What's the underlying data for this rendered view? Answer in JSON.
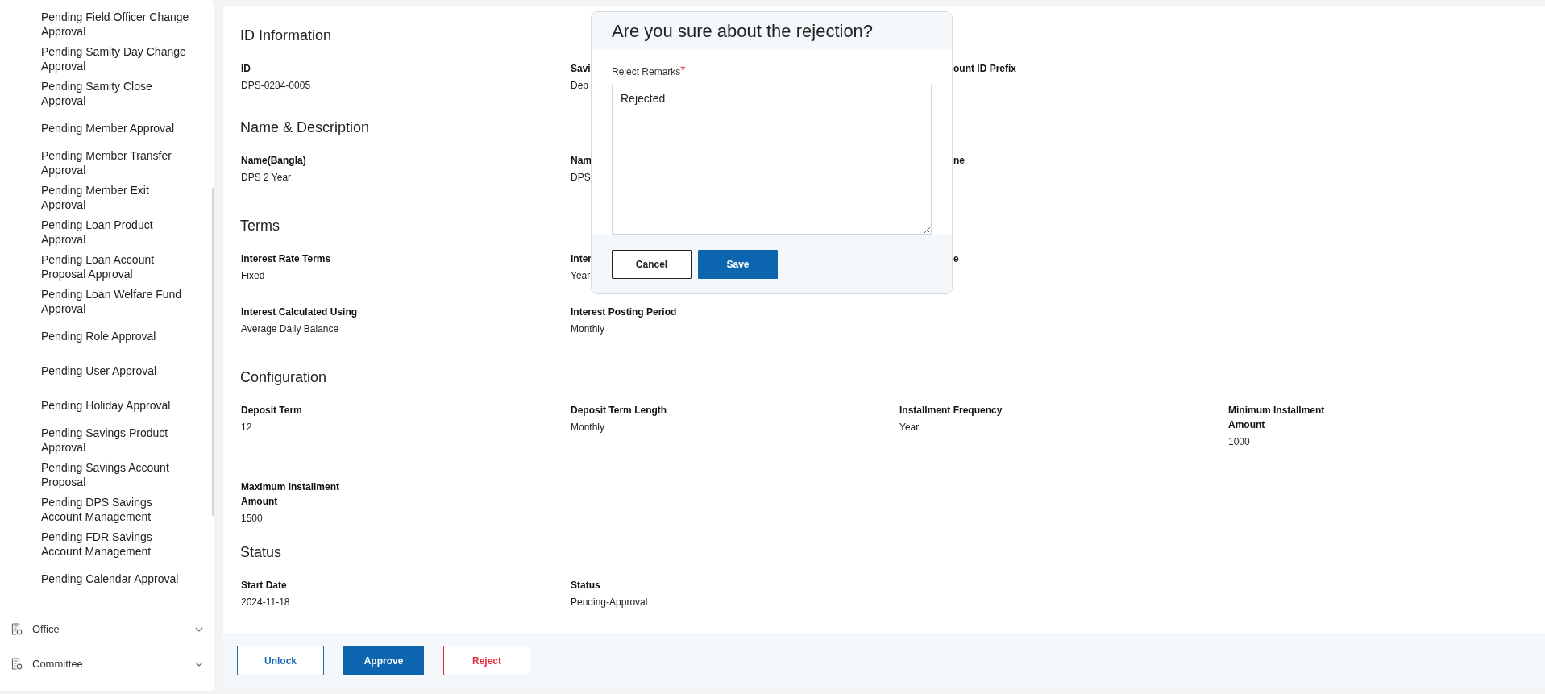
{
  "sidebar": {
    "items": [
      {
        "label": "Pending Field Officer Change Approval"
      },
      {
        "label": "Pending Samity Day Change Approval"
      },
      {
        "label": "Pending Samity Close Approval"
      },
      {
        "label": "Pending Member Approval"
      },
      {
        "label": "Pending Member Transfer Approval"
      },
      {
        "label": "Pending Member Exit Approval"
      },
      {
        "label": "Pending Loan Product Approval"
      },
      {
        "label": "Pending Loan Account Proposal Approval"
      },
      {
        "label": "Pending Loan Welfare Fund Approval"
      },
      {
        "label": "Pending Role Approval"
      },
      {
        "label": "Pending User Approval"
      },
      {
        "label": "Pending Holiday Approval"
      },
      {
        "label": "Pending Savings Product Approval"
      },
      {
        "label": "Pending Savings Account Proposal"
      },
      {
        "label": "Pending DPS Savings Account Management"
      },
      {
        "label": "Pending FDR Savings Account Management"
      },
      {
        "label": "Pending Calendar Approval"
      }
    ],
    "groups": [
      {
        "label": "Office",
        "expanded": false
      },
      {
        "label": "Committee",
        "expanded": false
      }
    ]
  },
  "sections": [
    {
      "title": "ID Information",
      "rows": [
        [
          {
            "label": "ID",
            "value": "DPS-0284-0005"
          },
          {
            "label": "Savi",
            "value": "Dep"
          },
          {
            "label": "ount ID Prefix"
          }
        ]
      ]
    },
    {
      "title": "Name & Description",
      "rows": [
        [
          {
            "label": "Name(Bangla)",
            "value": "DPS 2 Year"
          },
          {
            "label": "Nam",
            "value": "DPS"
          },
          {
            "label": "ne"
          }
        ]
      ]
    },
    {
      "title": "Terms",
      "rows": [
        [
          {
            "label": "Interest Rate Terms",
            "value": "Fixed"
          },
          {
            "label": "Inter",
            "value": "Year"
          },
          {
            "label": "e"
          }
        ],
        [
          {
            "label": "Interest Calculated Using",
            "value": "Average Daily Balance"
          },
          {
            "label": "Interest Posting Period",
            "value": "Monthly"
          }
        ]
      ]
    },
    {
      "title": "Configuration",
      "rows": [
        [
          {
            "label": "Deposit Term",
            "value": "12"
          },
          {
            "label": "Deposit Term Length",
            "value": "Monthly"
          },
          {
            "label": "Installment Frequency",
            "value": "Year"
          },
          {
            "label": "Minimum Installment Amount",
            "value": "1000"
          }
        ],
        [
          {
            "label": "Maximum Installment Amount",
            "value": "1500"
          }
        ]
      ]
    },
    {
      "title": "Status",
      "rows": [
        [
          {
            "label": "Start Date",
            "value": "2024-11-18"
          },
          {
            "label": "Status",
            "value": "Pending-Approval"
          }
        ]
      ]
    }
  ],
  "actions": [
    {
      "label": "Unlock",
      "kind": "outline"
    },
    {
      "label": "Approve",
      "kind": "primary"
    },
    {
      "label": "Reject",
      "kind": "danger"
    }
  ],
  "dialog": {
    "title": "Are you sure about the rejection?",
    "field_label": "Reject Remarks",
    "required": true,
    "required_mark": "*",
    "value": "Rejected",
    "buttons": [
      {
        "label": "Cancel",
        "kind": "outline"
      },
      {
        "label": "Save",
        "kind": "primary"
      }
    ]
  }
}
